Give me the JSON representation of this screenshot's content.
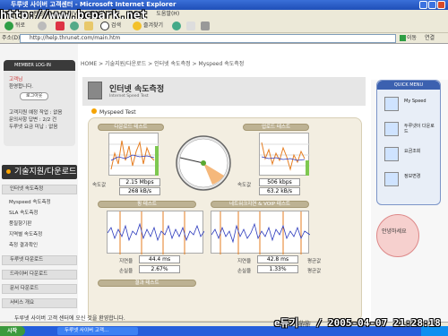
{
  "window": {
    "title": "두루넷 사이버 고객센터 - Microsoft Internet Explorer"
  },
  "watermark": "http://www.bcpark.net",
  "menubar": {
    "items": [
      "파일(F)",
      "편집(E)",
      "보기(V)",
      "즐겨찾기(A)",
      "도구(T)",
      "도움말(H)"
    ]
  },
  "toolbar": {
    "back": "뒤로",
    "search": "검색",
    "favorites": "즐겨찾기"
  },
  "addressbar": {
    "label": "주소(D)",
    "url": "http://help.thrunet.com/main.htm",
    "go": "이동",
    "links": "연결"
  },
  "member": {
    "header": "MEMBER LOG-IN",
    "greeting1": "고객님",
    "greeting2": "환영합니다.",
    "logout": "로그아웃",
    "stat1": "고객지원 예정 작업 : 없음",
    "stat2": "문의사항 답변 : 2/2 건",
    "stat3": "두루넷 요금 미납 : 없음"
  },
  "leftnav": {
    "section": "기술지원/다운로드",
    "items": [
      {
        "label": "인터넷 속도측정",
        "type": "head"
      },
      {
        "label": "Myspeed 속도측정",
        "type": "sub"
      },
      {
        "label": "SLA 속도측정",
        "type": "sub"
      },
      {
        "label": "품질향기판",
        "type": "sub"
      },
      {
        "label": "지역별 속도측정",
        "type": "sub"
      },
      {
        "label": "측정 결과확인",
        "type": "sub"
      },
      {
        "label": "두루넷 다운로드",
        "type": "head"
      },
      {
        "label": "드라이버 다운로드",
        "type": "head"
      },
      {
        "label": "문서 다운로드",
        "type": "head"
      },
      {
        "label": "서비스 개요",
        "type": "head"
      }
    ]
  },
  "breadcrumb": "HOME > 기술지원/다운로드 > 인터넷 속도측정 > Myspeed 속도측정",
  "page": {
    "title": "인터넷 속도측정",
    "subtitle": "Internet Speed Test",
    "test_label": "Myspeed Test"
  },
  "speedtest": {
    "download_header": "다운로드 테스트",
    "upload_header": "업로드 테스트",
    "speed_label": "속도값",
    "download_mbps": "2.15 Mbps",
    "download_kbs": "268 kB/s",
    "upload_kbps": "506 kbps",
    "upload_kbs": "63.2 kB/s",
    "ping_header": "핑 테스트",
    "voip_header": "네트워크지연 & VOIP 테스트",
    "latency_label": "지연율",
    "loss_label": "손실율",
    "ping_latency": "44.4 ms",
    "ping_loss": "2.67%",
    "voip_latency": "42.8 ms",
    "voip_loss": "1.33%",
    "average_label": "평균값",
    "result_header": "결과 테스트"
  },
  "quickmenu": {
    "header": "QUICK MENU",
    "items": [
      "My Speed",
      "두루넷이 다운로드",
      "요금조회",
      "정보변경"
    ]
  },
  "mascot_text": "안녕하세요",
  "statusbar": {
    "text": "두루넷 사이버 고객 센터에 오신 것을 환영합니다."
  },
  "taskbar": {
    "start": "시작",
    "item": "두루넷 사이버 고객..."
  },
  "stamp": "e듀기☆☆ / 2005-04-07 21:28:18",
  "colors": {
    "accent_orange": "#f5a300",
    "chart_blue": "#2d3bbd",
    "chart_orange": "#e67e22",
    "panel_bg": "#f3eee1"
  }
}
